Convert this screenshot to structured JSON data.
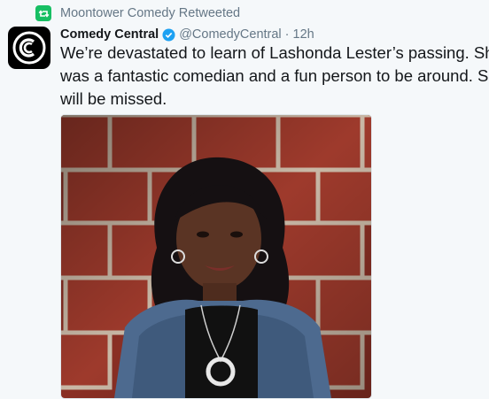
{
  "retweet": {
    "label": "Moontower Comedy Retweeted",
    "icon": "retweet-icon",
    "color": "#17bf63"
  },
  "tweet": {
    "avatar_icon": "comedy-central-logo",
    "display_name": "Comedy Central",
    "verified": true,
    "handle": "@ComedyCentral",
    "separator": "·",
    "time": "12h",
    "text_lines": [
      "We’re devastated to learn of Lashonda Lester’s passing. She",
      "was a fantastic comedian and a fun person to be around. She",
      "will be missed."
    ],
    "media": {
      "type": "photo"
    }
  },
  "colors": {
    "background": "#f5f8fa",
    "muted_text": "#657786",
    "verified_blue": "#1da1f2"
  }
}
